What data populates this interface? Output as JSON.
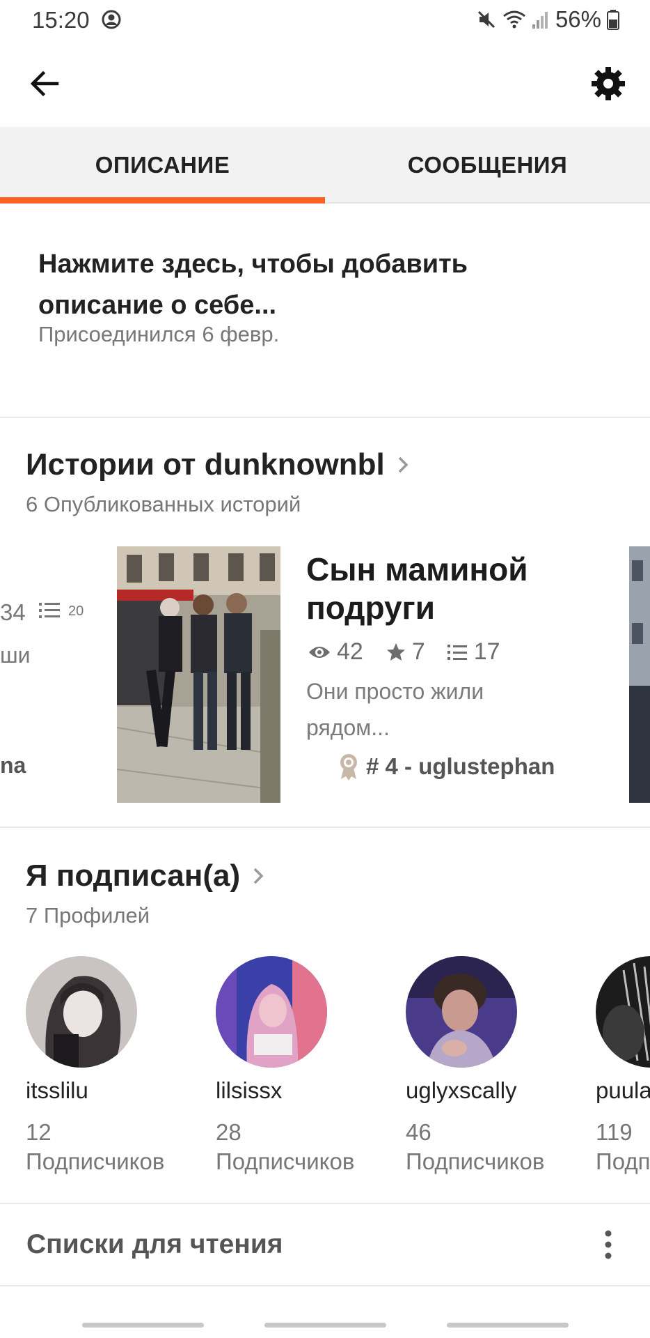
{
  "status_bar": {
    "time": "15:20",
    "battery_percent": "56%"
  },
  "tabs": [
    {
      "label": "ОПИСАНИЕ",
      "active": true
    },
    {
      "label": "СООБЩЕНИЯ",
      "active": false
    }
  ],
  "accent_color": "#ff6122",
  "description": {
    "prompt": "Нажмите здесь, чтобы добавить описание о себе...",
    "joined": "Присоединился 6 февр."
  },
  "stories": {
    "title": "Истории от dunknownbl",
    "subtitle": "6 Опубликованных историй",
    "previous_card": {
      "views_fragment": "34",
      "parts": "20",
      "blurb_fragment": "ши",
      "author_fragment": "na"
    },
    "featured": {
      "title": "Сын маминой подруги",
      "views": "42",
      "stars": "7",
      "parts": "17",
      "blurb": "Они просто жили рядом...",
      "rank": "# 4 - uglustephan"
    }
  },
  "following": {
    "title": "Я подписан(а)",
    "subtitle": "7 Профилей",
    "profiles": [
      {
        "name": "itsslilu",
        "followers": "12",
        "label": "Подписчиков"
      },
      {
        "name": "lilsissx",
        "followers": "28",
        "label": "Подписчиков"
      },
      {
        "name": "uglyxscally",
        "followers": "46",
        "label": "Подписчиков"
      },
      {
        "name": "puula",
        "followers": "119",
        "label": "Подписчиков"
      }
    ]
  },
  "reading_lists": {
    "title": "Списки для чтения"
  }
}
